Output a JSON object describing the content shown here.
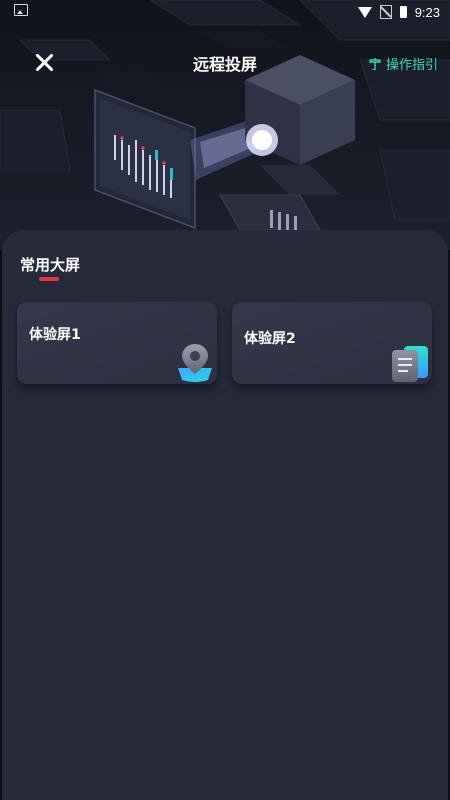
{
  "status_bar": {
    "time": "9:23"
  },
  "header": {
    "title": "远程投屏",
    "guide_label": "操作指引"
  },
  "section": {
    "title": "常用大屏"
  },
  "screens": [
    {
      "label": "体验屏1",
      "icon": "map-pin-icon"
    },
    {
      "label": "体验屏2",
      "icon": "notes-icon"
    }
  ],
  "colors": {
    "accent": "#3fd6ae",
    "underline": "#e0343f",
    "sheet": "#262a3a"
  }
}
